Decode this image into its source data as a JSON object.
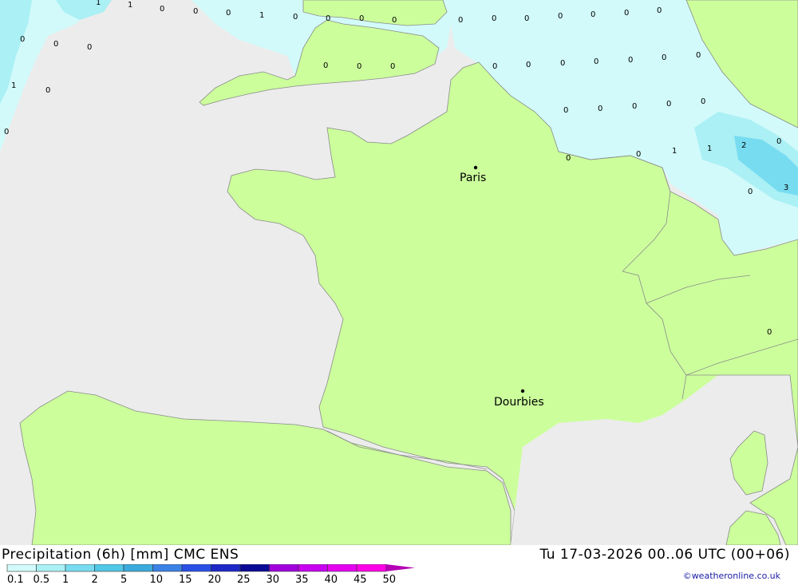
{
  "title": "Precipitation (6h) [mm] CMC ENS",
  "datetime": "Tu 17-03-2026 00..06 UTC (00+06)",
  "credit": "©weatheronline.co.uk",
  "colors": {
    "sea": "#ececec",
    "land": "#ccff9c",
    "border": "#8a8a8a",
    "precip_0_1": "#d2fafa",
    "precip_0_5": "#aaf0f5",
    "precip_1": "#78dcf0",
    "precip_2": "#50c8e6"
  },
  "legend": {
    "ticks": [
      "0.1",
      "0.5",
      "1",
      "2",
      "5",
      "10",
      "15",
      "20",
      "25",
      "30",
      "35",
      "40",
      "45",
      "50"
    ],
    "colors": [
      "#d2fafa",
      "#aaf0f5",
      "#78dcf0",
      "#50c8e6",
      "#3caadc",
      "#3c82e6",
      "#2850e6",
      "#1e28c8",
      "#0a0a96",
      "#a000dc",
      "#c800f0",
      "#e600f0",
      "#ff00e6",
      "#b400b4"
    ]
  },
  "cities": [
    {
      "name": "Paris"
    },
    {
      "name": "Dourbies"
    }
  ],
  "precip_labels": [
    "1",
    "1",
    "0",
    "0",
    "0",
    "1",
    "0",
    "0",
    "0",
    "0",
    "0",
    "0",
    "1",
    "0",
    "0",
    "0",
    "0",
    "0",
    "0",
    "0",
    "0",
    "0",
    "0",
    "0",
    "0",
    "0",
    "0",
    "0",
    "0",
    "0",
    "0",
    "0",
    "0",
    "0",
    "0",
    "0",
    "1",
    "2",
    "0",
    "3",
    "0",
    "0",
    "0",
    "0",
    "1",
    "0",
    "0"
  ]
}
